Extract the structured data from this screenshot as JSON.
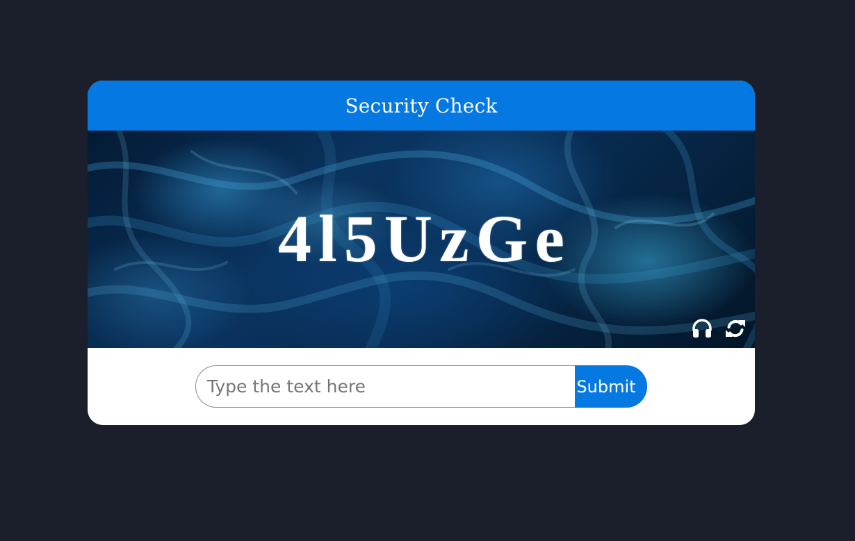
{
  "header": {
    "title": "Security Check"
  },
  "captcha": {
    "code": "4l5UzGe",
    "icons": [
      "headphones-icon",
      "refresh-icon"
    ]
  },
  "form": {
    "input_value": "",
    "input_placeholder": "Type the text here",
    "submit_label": "Submit"
  },
  "colors": {
    "page_background": "#1b1e2b",
    "accent": "#0578e2",
    "card_background": "#ffffff"
  }
}
